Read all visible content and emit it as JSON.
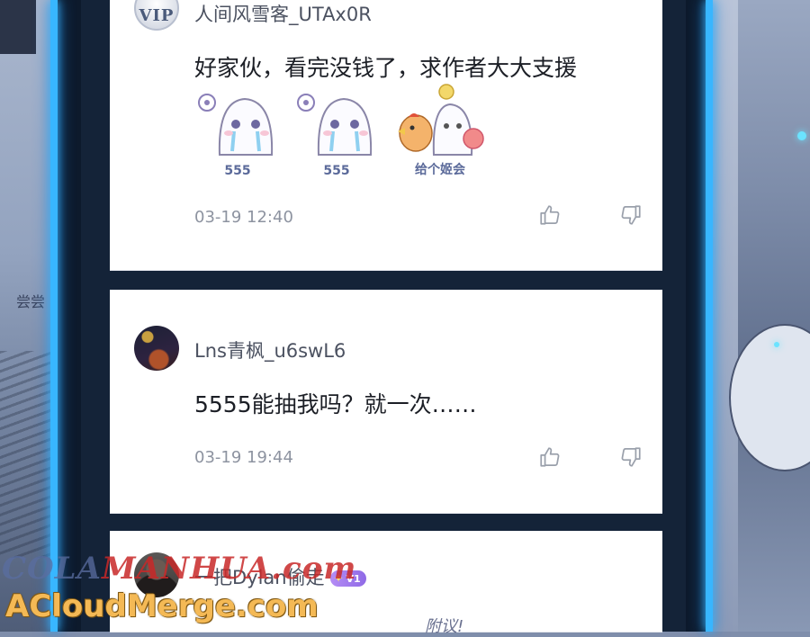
{
  "comments": [
    {
      "username": "人间风雪客_UTAx0R",
      "avatar_text": "VIP",
      "text": "好家伙，看完没钱了，求作者大大支援",
      "stickers": [
        "555",
        "555",
        "给个姬会"
      ],
      "time": "03-19 12:40"
    },
    {
      "username": "Lns青枫_u6swL6",
      "text": "5555能抽我吗？就一次……",
      "time": "03-19 19:44"
    },
    {
      "username": "一把Dylan偷走",
      "badge": "V1",
      "partial_text": "附议!"
    }
  ],
  "background": {
    "left_text": "尝尝"
  },
  "watermark": {
    "line1_a": "COLA",
    "line1_b": "MANHUA.com",
    "line2": "ACloudMerge.com"
  },
  "icons": {
    "like": "thumbs-up-icon",
    "dislike": "thumbs-down-icon"
  },
  "colors": {
    "frame_glow": "#38b6ff",
    "card_bg": "#ffffff",
    "badge": "#9b78ec",
    "watermark_gold": "#f4b955"
  }
}
